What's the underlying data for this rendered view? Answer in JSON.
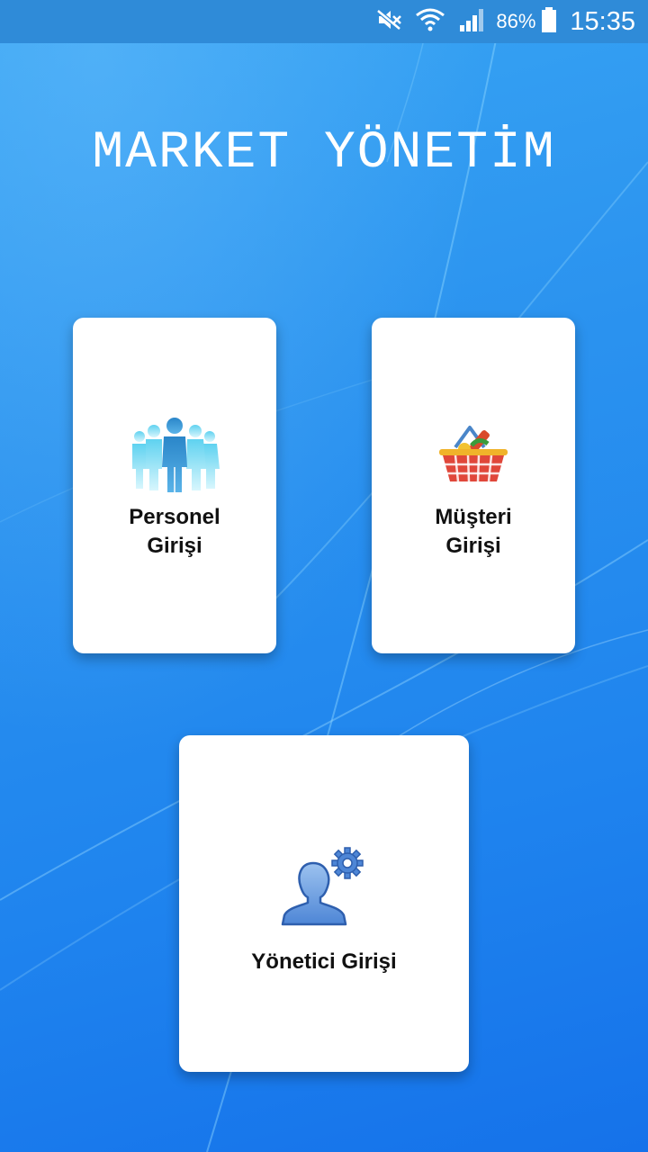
{
  "status_bar": {
    "battery_percent": "86%",
    "time": "15:35",
    "icons": [
      "mute-icon",
      "wifi-icon",
      "signal-icon",
      "battery-icon"
    ]
  },
  "app": {
    "title": "MARKET YÖNETİM"
  },
  "cards": {
    "personel": {
      "line1": "Personel",
      "line2": "Girişi",
      "icon": "people-group-icon"
    },
    "musteri": {
      "line1": "Müşteri",
      "line2": "Girişi",
      "icon": "shopping-basket-icon"
    },
    "yonetici": {
      "line1": "Yönetici Girişi",
      "icon": "admin-user-gear-icon"
    }
  },
  "colors": {
    "background": "#2b93ef",
    "status_bar": "#2f8bd8",
    "card": "#ffffff",
    "title": "#ffffff"
  }
}
